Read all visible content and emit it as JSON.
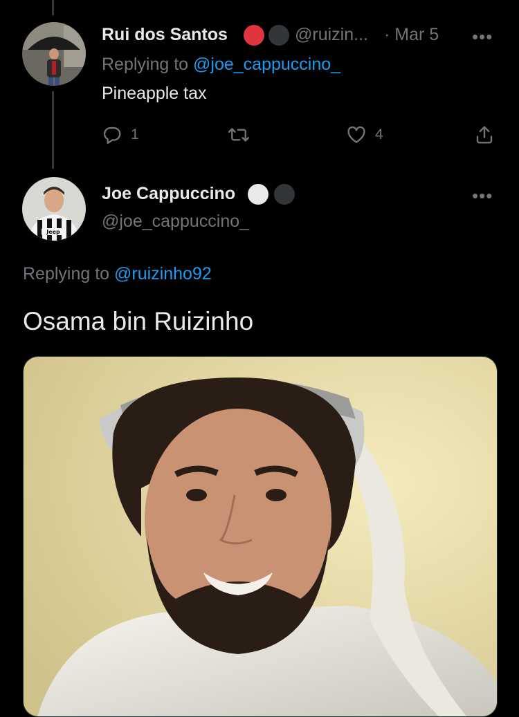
{
  "reply_tweet": {
    "author_name": "Rui dos Santos",
    "handle": "@ruizin...",
    "date": "· Mar 5",
    "replying_prefix": "Replying to",
    "replying_to": "@joe_cappuccino_",
    "text": "Pineapple tax",
    "reply_count": "1",
    "retweet_count": "",
    "like_count": "4",
    "badge_colors": [
      "#e0343e",
      "#333639"
    ]
  },
  "main_tweet": {
    "author_name": "Joe Cappuccino",
    "handle": "@joe_cappuccino_",
    "replying_prefix": "Replying to",
    "replying_to": "@ruizinho92",
    "text": "Osama bin Ruizinho",
    "badge_colors": [
      "#e7e9ea",
      "#333639"
    ]
  },
  "icons": {
    "reply": "reply-icon",
    "retweet": "retweet-icon",
    "like": "heart-icon",
    "share": "share-icon",
    "more": "more-icon"
  },
  "colors": {
    "accent": "#1d9bf0",
    "muted": "#71767b",
    "text": "#e7e9ea",
    "background": "#000000"
  }
}
